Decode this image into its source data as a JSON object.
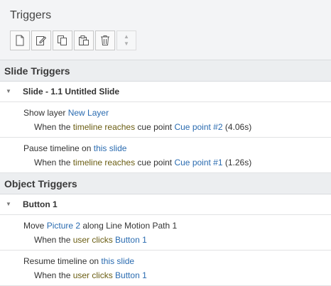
{
  "panel": {
    "title": "Triggers"
  },
  "toolbar": {
    "buttons": [
      "new-trigger",
      "edit-trigger",
      "copy-trigger",
      "paste-trigger",
      "delete-trigger",
      "move-up-down"
    ]
  },
  "slide_triggers": {
    "header": "Slide Triggers",
    "group": "Slide - 1.1 Untitled Slide",
    "items": [
      {
        "action": "Show layer ",
        "action_target": "New Layer",
        "when": "When the ",
        "event_subject": "timeline",
        "event_verb": " reaches",
        "event_rest": " cue point ",
        "event_target": "Cue point #2",
        "event_extra": " (4.06s)"
      },
      {
        "action": "Pause timeline on ",
        "action_target": "this slide",
        "when": "When the ",
        "event_subject": "timeline",
        "event_verb": " reaches",
        "event_rest": " cue point ",
        "event_target": "Cue point #1",
        "event_extra": " (1.26s)"
      }
    ]
  },
  "object_triggers": {
    "header": "Object Triggers",
    "group": "Button 1",
    "items": [
      {
        "action": "Move ",
        "action_target": "Picture 2",
        "action_rest": " along Line Motion Path 1",
        "when": "When the ",
        "event_subject": "user",
        "event_verb": " clicks ",
        "event_target": "Button 1"
      },
      {
        "action": "Resume timeline on ",
        "action_target": "this slide",
        "when": "When the ",
        "event_subject": "user",
        "event_verb": " clicks ",
        "event_target": "Button 1"
      }
    ]
  }
}
